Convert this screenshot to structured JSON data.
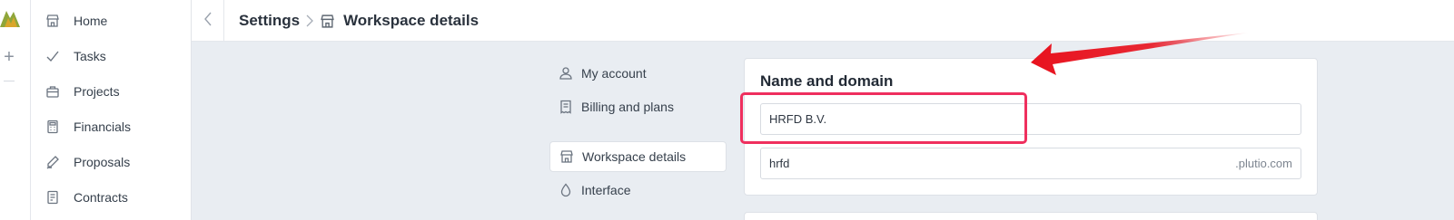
{
  "sidebar": {
    "items": [
      {
        "label": "Home",
        "icon": "home-icon"
      },
      {
        "label": "Tasks",
        "icon": "check-icon"
      },
      {
        "label": "Projects",
        "icon": "briefcase-icon"
      },
      {
        "label": "Financials",
        "icon": "calculator-icon"
      },
      {
        "label": "Proposals",
        "icon": "pen-icon"
      },
      {
        "label": "Contracts",
        "icon": "contract-icon"
      }
    ]
  },
  "header": {
    "breadcrumb_root": "Settings",
    "breadcrumb_current": "Workspace details"
  },
  "settings_nav": {
    "items": [
      {
        "label": "My account",
        "icon": "user-icon"
      },
      {
        "label": "Billing and plans",
        "icon": "receipt-icon"
      },
      {
        "label": "Workspace details",
        "icon": "store-icon",
        "active": true
      },
      {
        "label": "Interface",
        "icon": "drop-icon"
      }
    ]
  },
  "main": {
    "section_title": "Name and domain",
    "workspace_name": "HRFD B.V.",
    "domain_value": "hrfd",
    "domain_suffix": ".plutio.com"
  },
  "colors": {
    "highlight": "#ef2f5e",
    "arrow": "#e8121e",
    "background": "#e9edf2"
  }
}
